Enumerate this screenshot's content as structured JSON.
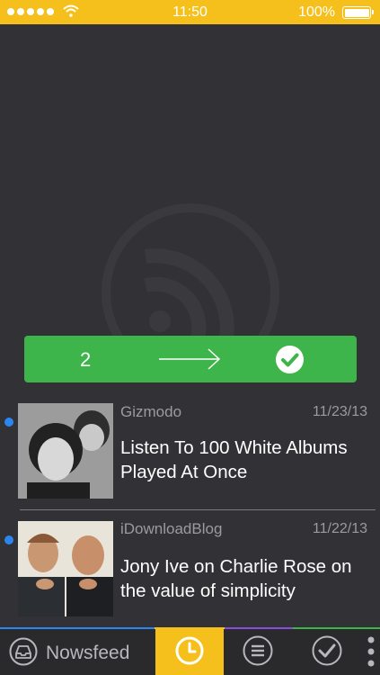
{
  "status_bar": {
    "time": "11:50",
    "battery": "100%"
  },
  "swipe_bar": {
    "count": "2",
    "color": "#3db54a"
  },
  "feed": {
    "items": [
      {
        "source": "Gizmodo",
        "date": "11/23/13",
        "title": "Listen To 100 White Albums Played At Once",
        "unread": true
      },
      {
        "source": "iDownloadBlog",
        "date": "11/22/13",
        "title": "Jony Ive on Charlie Rose on the value of simplicity",
        "unread": true
      }
    ]
  },
  "tab_bar": {
    "newsfeed_label": "Nowsfeed",
    "active_tab": "recent",
    "accent_color": "#f5c01b"
  }
}
